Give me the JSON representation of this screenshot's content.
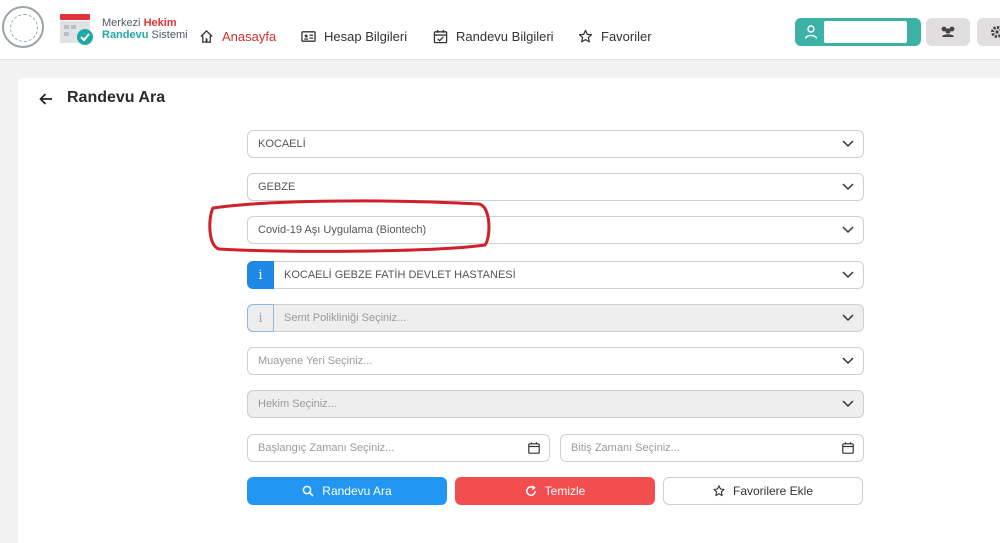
{
  "header": {
    "brand_line1_a": "Merkezi ",
    "brand_line1_b": "Hekim",
    "brand_line2_a": "Randevu",
    "brand_line2_b": " Sistemi",
    "nav": [
      {
        "label": "Anasayfa",
        "icon": "home-icon"
      },
      {
        "label": "Hesap Bilgileri",
        "icon": "id-card-icon"
      },
      {
        "label": "Randevu Bilgileri",
        "icon": "calendar-check-icon"
      },
      {
        "label": "Favoriler",
        "icon": "star-icon"
      }
    ],
    "user_name": ""
  },
  "page": {
    "title": "Randevu Ara"
  },
  "form": {
    "il": "KOCAELİ",
    "ilce": "GEBZE",
    "klinik": "Covid-19 Aşı Uygulama (Biontech)",
    "hastane": "KOCAELİ GEBZE FATİH DEVLET HASTANESİ",
    "semt_placeholder": "Semt Polikliniği Seçiniz...",
    "muayene_placeholder": "Muayene Yeri Seçiniz...",
    "hekim_placeholder": "Hekim Seçiniz...",
    "baslangic_placeholder": "Başlangıç Zamanı Seçiniz...",
    "bitis_placeholder": "Bitiş Zamanı Seçiniz...",
    "info_glyph": "i"
  },
  "buttons": {
    "search": "Randevu Ara",
    "clear": "Temizle",
    "favorite": "Favorilere Ekle"
  },
  "colors": {
    "primary": "#2196f3",
    "danger": "#f24d4f",
    "teal": "#3cb2a6",
    "active_nav": "#d32f2f",
    "annotation": "#d0202a"
  }
}
